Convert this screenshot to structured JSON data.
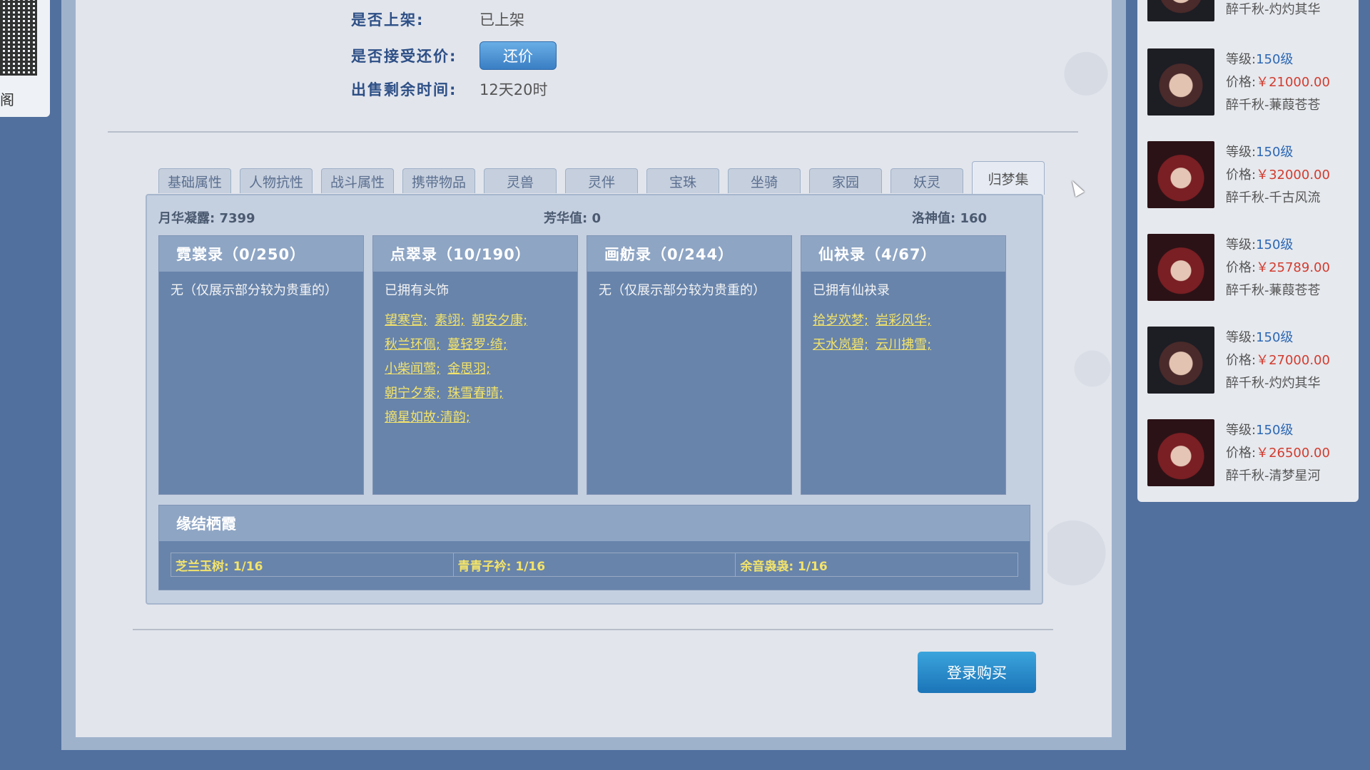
{
  "qr": {
    "label": "阁"
  },
  "listing": {
    "rows": [
      {
        "label": "是否上架:",
        "value": "已上架"
      },
      {
        "label": "是否接受还价:",
        "button": "还价"
      },
      {
        "label": "出售剩余时间:",
        "value": "12天20时"
      }
    ]
  },
  "tabs": [
    {
      "label": "基础属性"
    },
    {
      "label": "人物抗性"
    },
    {
      "label": "战斗属性"
    },
    {
      "label": "携带物品"
    },
    {
      "label": "灵兽"
    },
    {
      "label": "灵伴"
    },
    {
      "label": "宝珠"
    },
    {
      "label": "坐骑"
    },
    {
      "label": "家园"
    },
    {
      "label": "妖灵"
    },
    {
      "label": "归梦集",
      "active": true
    }
  ],
  "stats": {
    "moon": "月华凝露: 7399",
    "fang": "芳华值: 0",
    "luo": "洛神值: 160"
  },
  "cards": [
    {
      "title": "霓裳录（0/250）",
      "note": "无（仅展示部分较为贵重的）",
      "links": []
    },
    {
      "title": "点翠录（10/190）",
      "note": "已拥有头饰",
      "links": [
        [
          "望寒宫;",
          "素翊;",
          "朝安夕康;"
        ],
        [
          "秋兰环佩;",
          "蔓轻罗·绮;"
        ],
        [
          "小柴闻莺;",
          "金思羽;"
        ],
        [
          "朝宁夕泰;",
          "珠雪春晴;"
        ],
        [
          "摘星如故·清韵;"
        ]
      ]
    },
    {
      "title": "画舫录（0/244）",
      "note": "无（仅展示部分较为贵重的）",
      "links": []
    },
    {
      "title": "仙袂录（4/67）",
      "note": "已拥有仙袂录",
      "links": [
        [
          "拾岁欢梦;",
          "岩彩风华;"
        ],
        [
          "天水岚碧;",
          "云川拂雪;"
        ]
      ]
    }
  ],
  "bond": {
    "title": "缘结栖霞",
    "cells": [
      "芝兰玉树: 1/16",
      "青青子衿: 1/16",
      "余音袅袅: 1/16"
    ]
  },
  "buy_button": "登录购买",
  "sidebar": {
    "top_name": "醉千秋-灼灼其华",
    "items": [
      {
        "level_label": "等级:",
        "level": "150级",
        "price_label": "价格:",
        "price": "￥21000.00",
        "name": "醉千秋-蒹葭苍苍",
        "style": "dark"
      },
      {
        "level_label": "等级:",
        "level": "150级",
        "price_label": "价格:",
        "price": "￥32000.00",
        "name": "醉千秋-千古风流",
        "style": "red"
      },
      {
        "level_label": "等级:",
        "level": "150级",
        "price_label": "价格:",
        "price": "￥25789.00",
        "name": "醉千秋-蒹葭苍苍",
        "style": "red"
      },
      {
        "level_label": "等级:",
        "level": "150级",
        "price_label": "价格:",
        "price": "￥27000.00",
        "name": "醉千秋-灼灼其华",
        "style": "dark"
      },
      {
        "level_label": "等级:",
        "level": "150级",
        "price_label": "价格:",
        "price": "￥26500.00",
        "name": "醉千秋-清梦星河",
        "style": "red"
      }
    ]
  }
}
